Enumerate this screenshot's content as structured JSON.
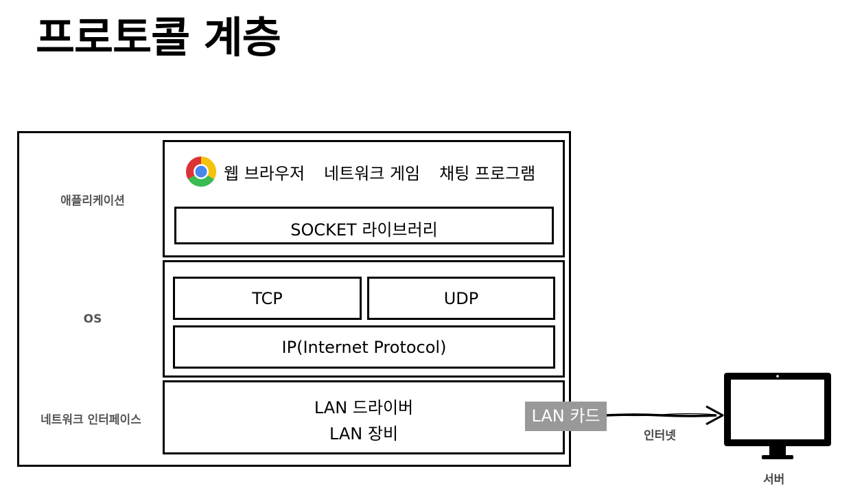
{
  "title": "프로토콜 계층",
  "layers": {
    "application": "애플리케이션",
    "os": "OS",
    "network_interface": "네트워크 인터페이스"
  },
  "application_box": {
    "items": [
      "웹 브라우저",
      "네트워크 게임",
      "채팅 프로그램"
    ],
    "socket": "SOCKET 라이브러리",
    "icon": "chrome-icon"
  },
  "os_box": {
    "tcp": "TCP",
    "udp": "UDP",
    "ip": "IP(Internet Protocol)"
  },
  "network_box": {
    "line1": "LAN 드라이버",
    "line2": "LAN 장비",
    "card": "LAN 카드"
  },
  "connection": {
    "label": "인터넷"
  },
  "server": {
    "label": "서버",
    "icon": "monitor-icon"
  }
}
